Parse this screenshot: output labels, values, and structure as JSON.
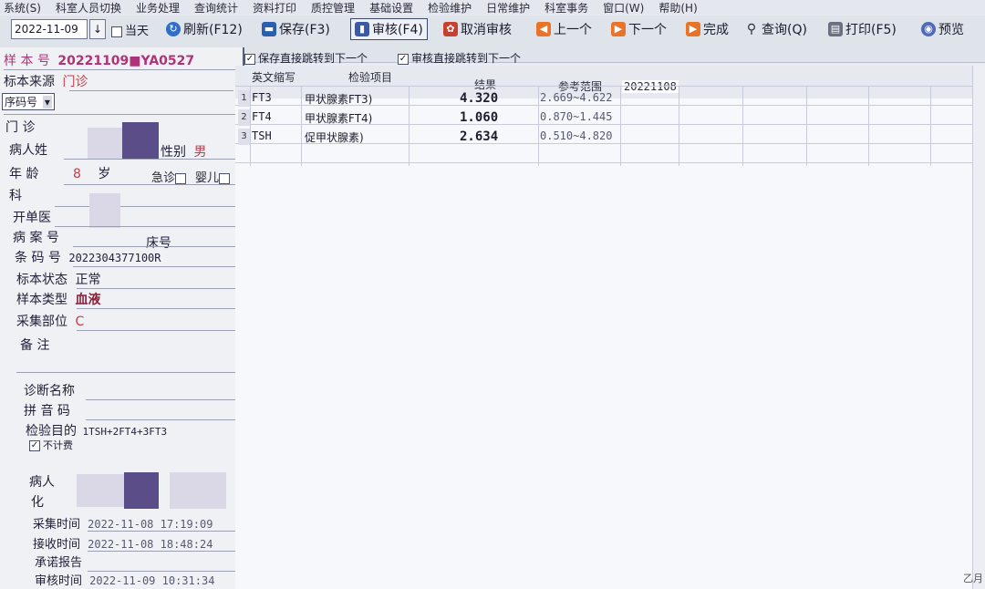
{
  "menu": [
    "系统(S)",
    "科室人员切换",
    "业务处理",
    "查询统计",
    "资料打印",
    "质控管理",
    "基础设置",
    "检验维护",
    "日常维护",
    "科室事务",
    "窗口(W)",
    "帮助(H)"
  ],
  "toolbar": {
    "date": "2022-11-09",
    "today_label": "当天",
    "refresh": "刷新(F12)",
    "save": "保存(F3)",
    "review": "审核(F4)",
    "cancel_review": "取消审核",
    "prev": "上一个",
    "next": "下一个",
    "finish": "完成",
    "query": "查询(Q)",
    "print": "打印(F5)",
    "preview": "预览",
    "opt_save_jump": "保存直接跳转到下一个",
    "opt_review_jump": "审核直接跳转到下一个"
  },
  "sample": {
    "label_no": "样 本 号",
    "no": "20221109■YA0527",
    "label_source": "标本来源",
    "source": "门诊",
    "label_seq": "序码号",
    "label_outpatient": "门 诊",
    "label_name": "病人姓",
    "label_sex": "性别",
    "sex": "男",
    "label_age": "年    龄",
    "age": "8",
    "age_unit": "岁",
    "label_urgent": "急诊",
    "label_infant": "婴儿",
    "label_dept": "科",
    "label_doctor": "开单医",
    "label_case": "病 案 号",
    "label_bed": "床号",
    "label_barcode": "条 码 号",
    "barcode": "2022304377100R",
    "label_status": "标本状态",
    "status": "正常",
    "label_type": "样本类型",
    "type": "血液",
    "label_site": "采集部位",
    "site": "C",
    "label_remark": "备    注",
    "label_diag": "诊断名称",
    "label_pinyin": "拼 音 码",
    "label_purpose": "检验目的",
    "purpose": "1TSH+2FT4+3FT3",
    "label_nofee": "不计费",
    "label_patient": "病人",
    "label_lab": "化",
    "label_collect_time": "采集时间",
    "collect_time": "2022-11-08  17:19:09",
    "label_receive_time": "接收时间",
    "receive_time": "2022-11-08  18:48:24",
    "label_promise": "承诺报告",
    "label_review_time": "审核时间",
    "review_time": "2022-11-09  10:31:34"
  },
  "grid": {
    "headers": [
      "英文缩写",
      "检验项目",
      "结果",
      "参考范围"
    ],
    "extra_header": "20221108",
    "rows": [
      {
        "num": "1",
        "code": "FT3",
        "name": "甲状腺素FT3)",
        "result": "4.320",
        "range": "2.669~4.622"
      },
      {
        "num": "2",
        "code": "FT4",
        "name": "甲状腺素FT4)",
        "result": "1.060",
        "range": "0.870~1.445"
      },
      {
        "num": "3",
        "code": "TSH",
        "name": "促甲状腺素)",
        "result": "2.634",
        "range": "0.510~4.820"
      }
    ]
  },
  "status_corner": "乙月"
}
